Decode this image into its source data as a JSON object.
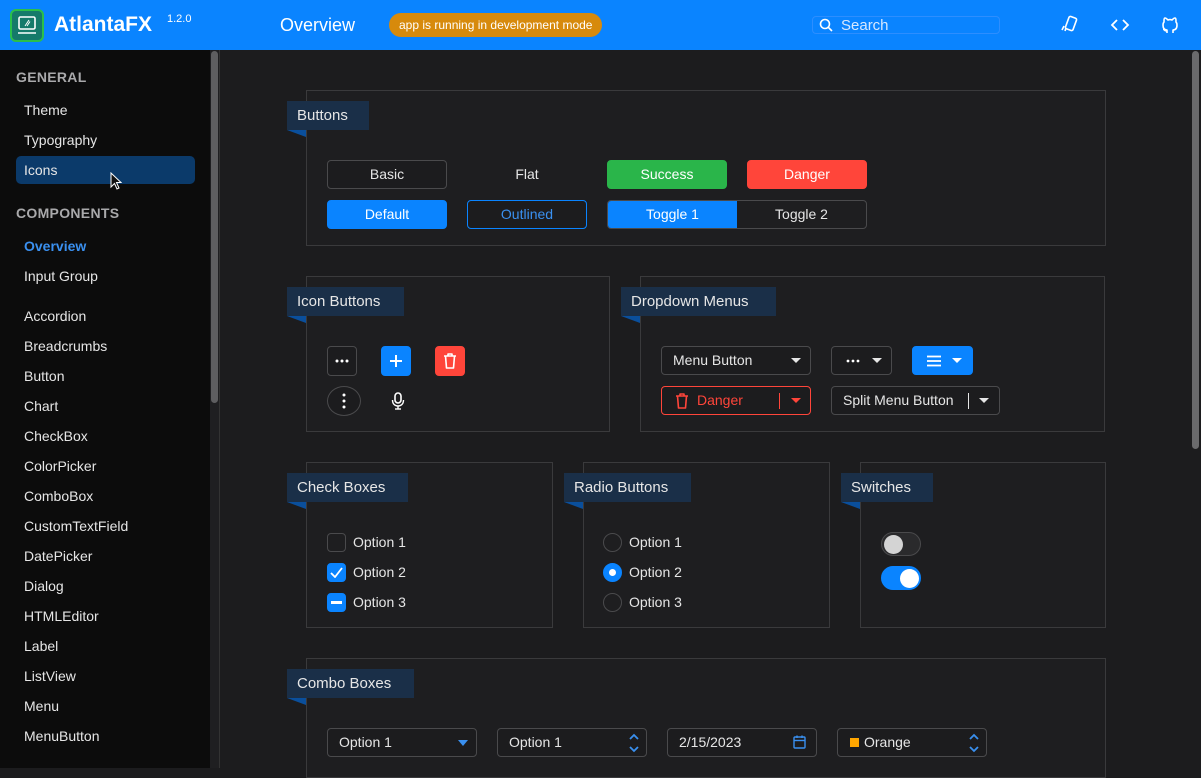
{
  "header": {
    "app_name": "AtlantaFX",
    "version": "1.2.0",
    "page_title": "Overview",
    "badge": "app is running in development mode",
    "search_placeholder": "Search",
    "brand_color": "#0a84ff",
    "icons": [
      "theme-switch-icon",
      "source-code-icon",
      "github-icon"
    ]
  },
  "sidebar": {
    "sections": [
      {
        "title": "GENERAL",
        "items": [
          {
            "label": "Theme"
          },
          {
            "label": "Typography"
          },
          {
            "label": "Icons",
            "state": "hovered"
          }
        ]
      },
      {
        "title": "COMPONENTS",
        "items": [
          {
            "label": "Overview",
            "state": "active"
          },
          {
            "label": "Input Group"
          },
          {
            "label": "Accordion"
          },
          {
            "label": "Breadcrumbs"
          },
          {
            "label": "Button"
          },
          {
            "label": "Chart"
          },
          {
            "label": "CheckBox"
          },
          {
            "label": "ColorPicker"
          },
          {
            "label": "ComboBox"
          },
          {
            "label": "CustomTextField"
          },
          {
            "label": "DatePicker"
          },
          {
            "label": "Dialog"
          },
          {
            "label": "HTMLEditor"
          },
          {
            "label": "Label"
          },
          {
            "label": "ListView"
          },
          {
            "label": "Menu"
          },
          {
            "label": "MenuButton"
          }
        ]
      }
    ]
  },
  "cards": {
    "buttons": {
      "title": "Buttons",
      "basic": "Basic",
      "flat": "Flat",
      "success": "Success",
      "danger": "Danger",
      "default": "Default",
      "outlined": "Outlined",
      "toggle1": "Toggle 1",
      "toggle2": "Toggle 2",
      "selected_toggle": "Toggle 1"
    },
    "icon_buttons": {
      "title": "Icon Buttons",
      "icons": [
        "more-horizontal-icon",
        "plus-icon",
        "trash-icon",
        "more-vertical-icon",
        "microphone-icon"
      ]
    },
    "dropdown_menus": {
      "title": "Dropdown Menus",
      "menu_button": "Menu Button",
      "danger": "Danger",
      "split_menu_button": "Split Menu Button"
    },
    "check_boxes": {
      "title": "Check Boxes",
      "options": [
        {
          "label": "Option 1",
          "state": "unchecked"
        },
        {
          "label": "Option 2",
          "state": "checked"
        },
        {
          "label": "Option 3",
          "state": "indeterminate"
        }
      ]
    },
    "radio_buttons": {
      "title": "Radio Buttons",
      "options": [
        {
          "label": "Option 1",
          "selected": false
        },
        {
          "label": "Option 2",
          "selected": true
        },
        {
          "label": "Option 3",
          "selected": false
        }
      ]
    },
    "switches": {
      "title": "Switches",
      "states": [
        false,
        true
      ]
    },
    "combo_boxes": {
      "title": "Combo Boxes",
      "combo_value": "Option 1",
      "spinner_value": "Option 1",
      "date_value": "2/15/2023",
      "color_value": "Orange",
      "color_swatch": "#ffa600"
    }
  }
}
